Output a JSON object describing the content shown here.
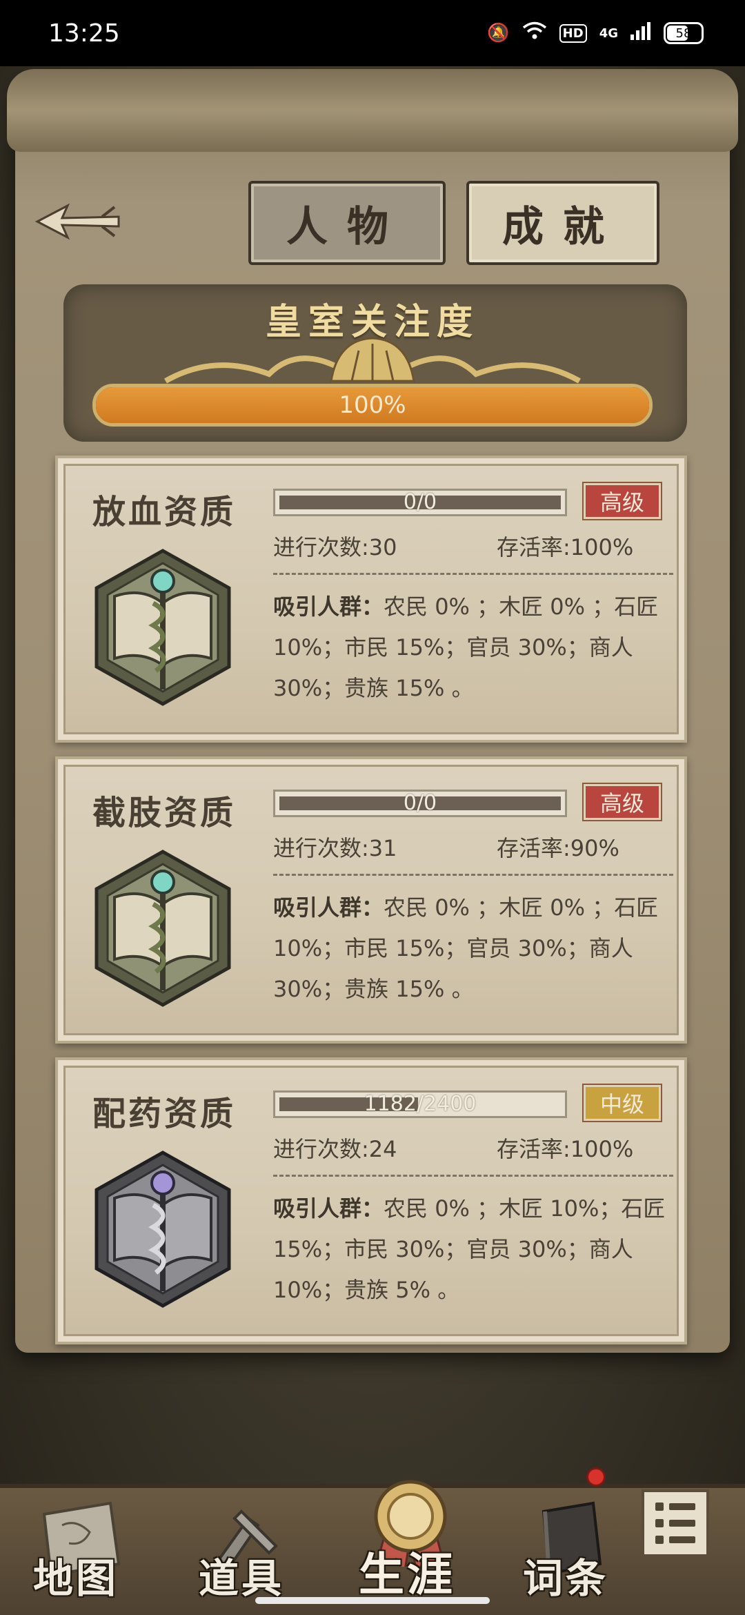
{
  "status_bar": {
    "time": "13:25",
    "hd": "HD",
    "network": "4G",
    "battery": "58"
  },
  "header": {
    "back_icon": "arrow-left-icon",
    "tabs": [
      {
        "label": "人物"
      },
      {
        "label": "成就"
      }
    ]
  },
  "royal": {
    "title": "皇室关注度",
    "progress_label": "100%",
    "progress": 1.0
  },
  "cards": [
    {
      "title": "放血资质",
      "progress_label": "0/0",
      "progress": 1.0,
      "level": "高级",
      "count_label": "进行次数:30",
      "survival_label": "存活率:100%",
      "attract_lead": "吸引人群：",
      "attract_text": "农民 0% ；木匠 0% ；石匠 10%；市民 15%；官员 30%；商人 30%；贵族 15% 。",
      "emblem": "caduceus-book-emblem-icon",
      "level_color": "#b8453e"
    },
    {
      "title": "截肢资质",
      "progress_label": "0/0",
      "progress": 1.0,
      "level": "高级",
      "count_label": "进行次数:31",
      "survival_label": "存活率:90%",
      "attract_lead": "吸引人群：",
      "attract_text": "农民 0% ；木匠 0% ；石匠 10%；市民 15%；官员 30%；商人 30%；贵族 15% 。",
      "emblem": "caduceus-book-emblem-icon",
      "level_color": "#b8453e"
    },
    {
      "title": "配药资质",
      "progress_label": "1182/2400",
      "progress": 0.4925,
      "level": "中级",
      "count_label": "进行次数:24",
      "survival_label": "存活率:100%",
      "attract_lead": "吸引人群：",
      "attract_text": "农民 0% ；木匠 10%；石匠 15%；市民 30%；官员 30%；商人 10%；贵族 5% 。",
      "emblem": "caduceus-silver-emblem-icon",
      "level_color": "#c8a23e"
    }
  ],
  "nav": {
    "items": [
      {
        "label": "地图",
        "icon": "map-icon"
      },
      {
        "label": "道具",
        "icon": "tools-icon"
      },
      {
        "label": "生涯",
        "icon": "medal-icon"
      },
      {
        "label": "词条",
        "icon": "book-icon"
      }
    ],
    "menu_icon": "list-menu-icon"
  }
}
